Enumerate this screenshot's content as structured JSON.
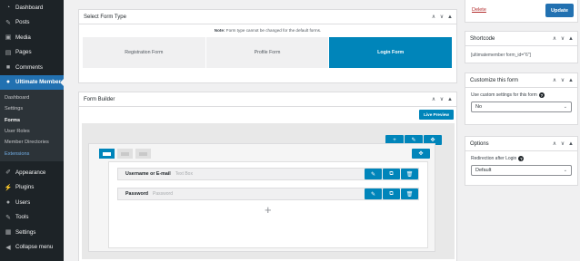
{
  "sidebar": {
    "menu_top": [
      {
        "label": "Dashboard",
        "icon": "dashboard-icon",
        "glyph": "◔"
      },
      {
        "label": "Posts",
        "icon": "pin-icon",
        "glyph": "✎"
      },
      {
        "label": "Media",
        "icon": "media-icon",
        "glyph": "▣"
      },
      {
        "label": "Pages",
        "icon": "page-icon",
        "glyph": "▤"
      },
      {
        "label": "Comments",
        "icon": "comment-icon",
        "glyph": "■"
      }
    ],
    "active": {
      "label": "Ultimate Member",
      "icon": "user-icon",
      "glyph": "●"
    },
    "submenu": [
      {
        "label": "Dashboard",
        "state": "normal"
      },
      {
        "label": "Settings",
        "state": "normal"
      },
      {
        "label": "Forms",
        "state": "current"
      },
      {
        "label": "User Roles",
        "state": "normal"
      },
      {
        "label": "Member Directories",
        "state": "normal"
      },
      {
        "label": "Extensions",
        "state": "highlight"
      }
    ],
    "menu_bottom": [
      {
        "label": "Appearance",
        "icon": "brush-icon",
        "glyph": "✐"
      },
      {
        "label": "Plugins",
        "icon": "plugin-icon",
        "glyph": "⚡"
      },
      {
        "label": "Users",
        "icon": "users-icon",
        "glyph": "●"
      },
      {
        "label": "Tools",
        "icon": "wrench-icon",
        "glyph": "✎"
      },
      {
        "label": "Settings",
        "icon": "settings-icon",
        "glyph": "▦"
      },
      {
        "label": "Collapse menu",
        "icon": "collapse-icon",
        "glyph": "◀"
      }
    ]
  },
  "select_form_type": {
    "title": "Select Form Type",
    "note_strong": "Note:",
    "note_text": " Form type cannot be changed for the default forms.",
    "tabs": [
      "Registration Form",
      "Profile Form",
      "Login Form"
    ],
    "active_tab": 2
  },
  "form_builder": {
    "title": "Form Builder",
    "live_preview": "Live Preview",
    "fields": [
      {
        "label": "Username or E-mail",
        "type": "Text Box"
      },
      {
        "label": "Password",
        "type": "Password"
      }
    ],
    "add_field": "+"
  },
  "publish": {
    "delete": "Delete",
    "update": "Update"
  },
  "shortcode": {
    "title": "Shortcode",
    "value": "[ultimatemember form_id=\"6\"]"
  },
  "customize": {
    "title": "Customize this form",
    "label": "Use custom settings for this form",
    "value": "No"
  },
  "options": {
    "title": "Options",
    "label": "Redirection after Login",
    "value": "Default"
  },
  "glyphs": {
    "up": "∧",
    "down": "∨",
    "toggle": "▲",
    "plus": "+",
    "edit": "✎",
    "move": "✥",
    "duplicate": "⧉",
    "delete": "🗑",
    "chevron": "⌄",
    "help": "?"
  },
  "colors": {
    "primary": "#0085ba",
    "wp_blue": "#2271b1",
    "sidebar": "#1d2327",
    "delete": "#b32d2e"
  }
}
